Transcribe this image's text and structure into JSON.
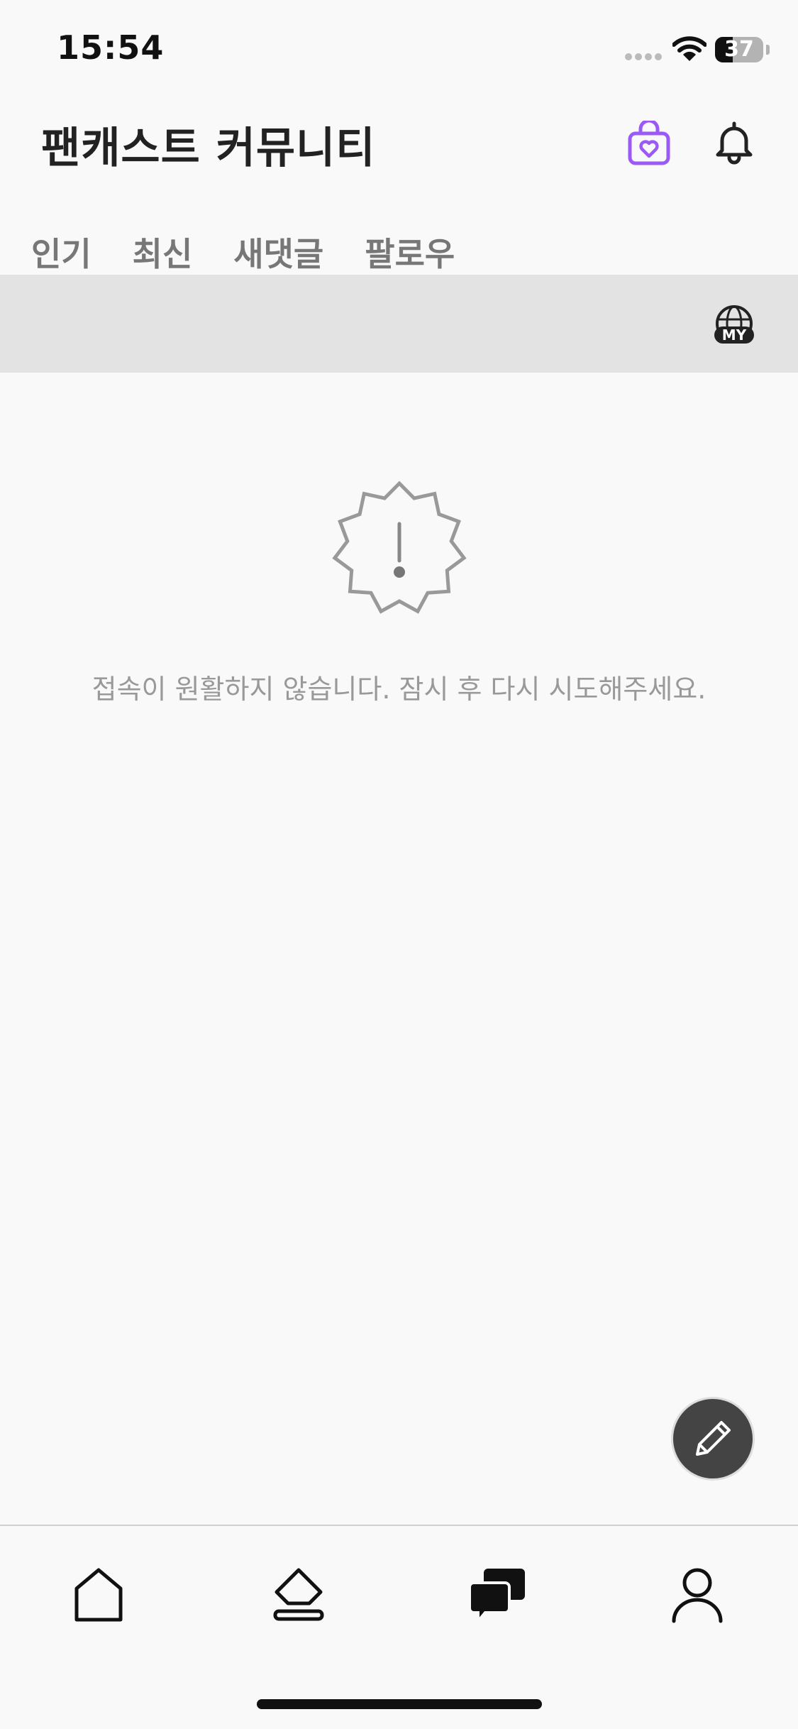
{
  "status_bar": {
    "time": "15:54",
    "battery_level": "37",
    "battery_fraction": 0.37
  },
  "header": {
    "title": "팬캐스트 커뮤니티",
    "icons": [
      "shop-heart-icon",
      "bell-icon"
    ],
    "accent_color": "#9b59f5"
  },
  "tabs": [
    {
      "label": "인기"
    },
    {
      "label": "최신"
    },
    {
      "label": "새댓글"
    },
    {
      "label": "팔로우"
    }
  ],
  "filter_bar": {
    "icon": "my-globe-icon",
    "icon_label": "MY"
  },
  "error": {
    "icon": "warning-badge-icon",
    "message": "접속이 원활하지 않습니다. 잠시 후 다시 시도해주세요."
  },
  "fab": {
    "icon": "pencil-icon"
  },
  "bottom_nav": {
    "items": [
      {
        "icon": "home-icon"
      },
      {
        "icon": "eraser-icon"
      },
      {
        "icon": "chat-bubbles-icon",
        "active": true
      },
      {
        "icon": "person-icon"
      }
    ]
  }
}
